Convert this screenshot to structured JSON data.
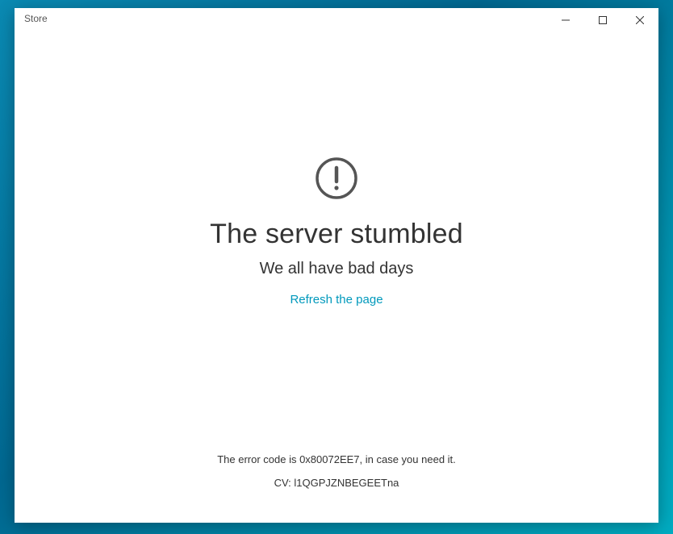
{
  "window": {
    "title": "Store"
  },
  "error": {
    "heading": "The server stumbled",
    "subheading": "We all have bad days",
    "refresh_label": "Refresh the page",
    "code_line": "The error code is 0x80072EE7, in case you need it.",
    "cv_line": "CV: l1QGPJZNBEGEETna"
  }
}
